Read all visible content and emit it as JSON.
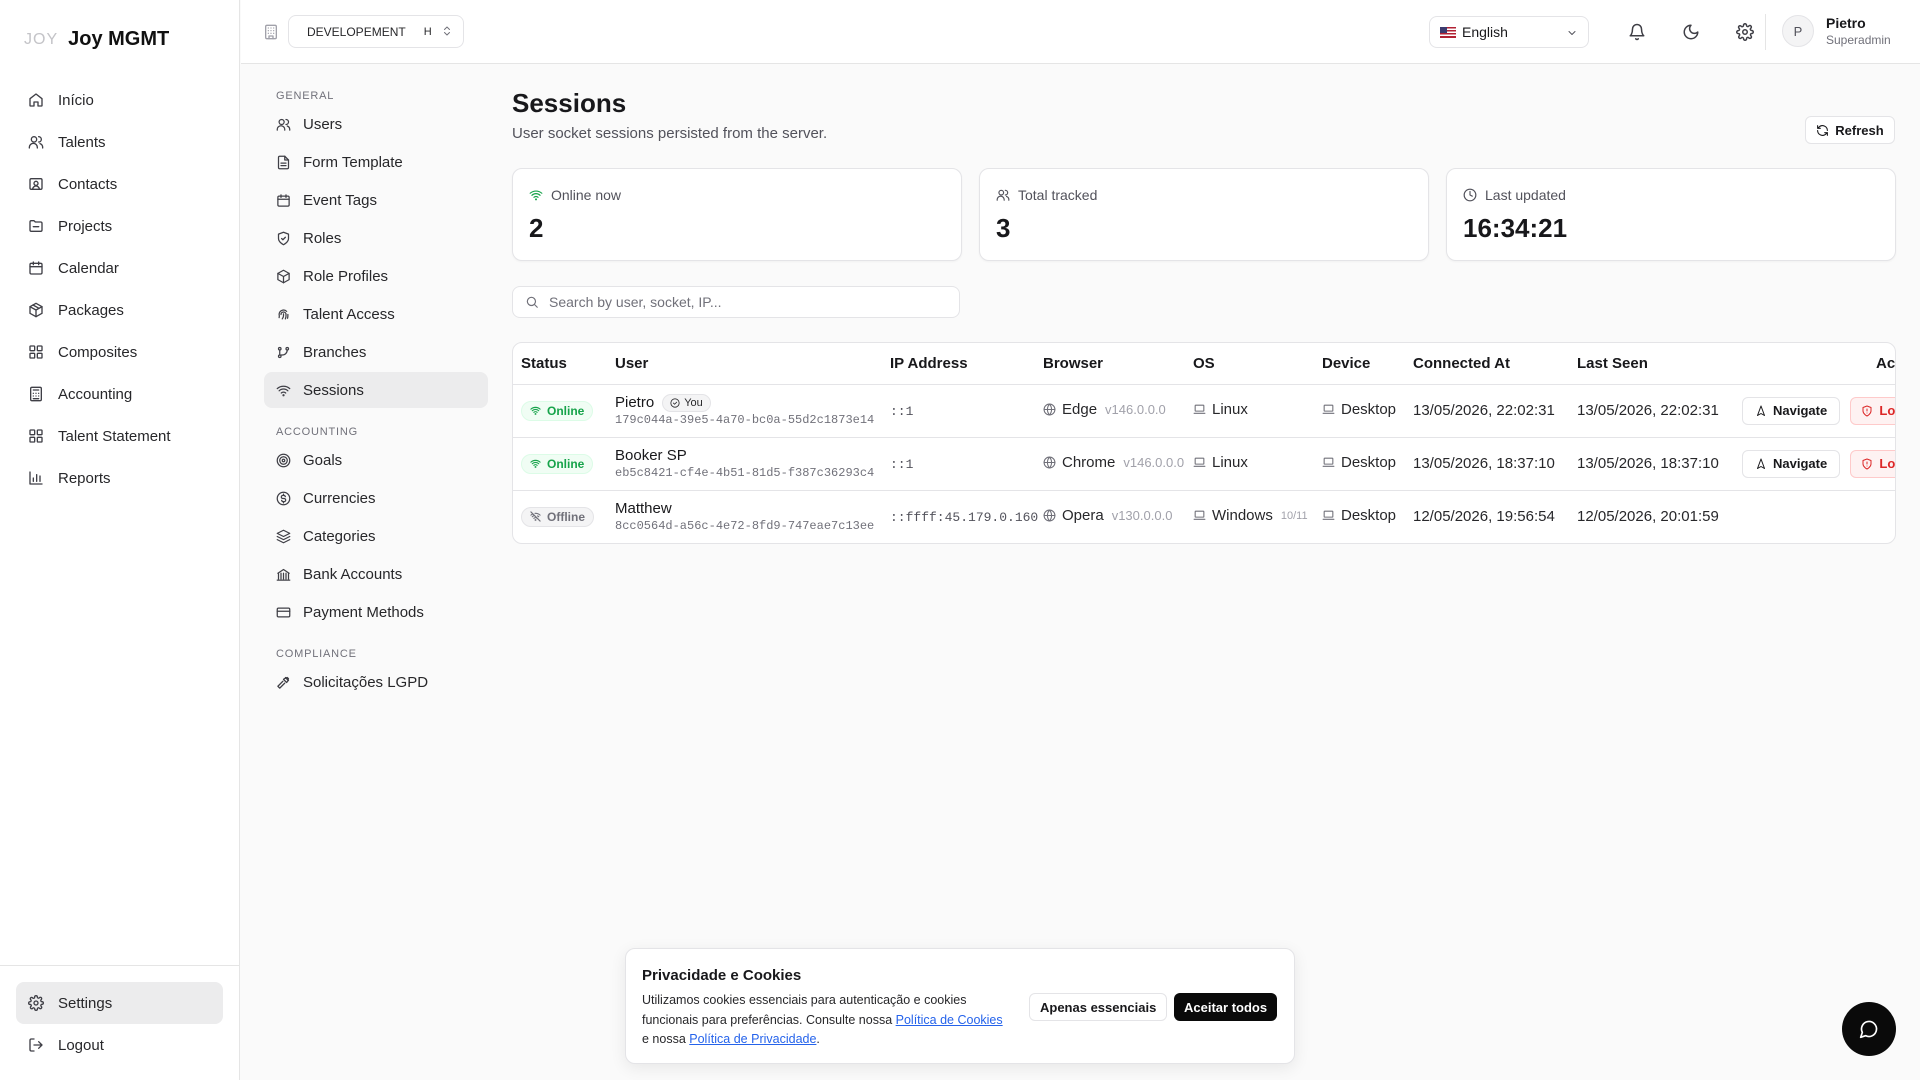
{
  "brand": {
    "logo": "JOY",
    "name": "Joy MGMT"
  },
  "sidebar": {
    "items": [
      {
        "label": "Início",
        "icon": "home-icon"
      },
      {
        "label": "Talents",
        "icon": "users-icon"
      },
      {
        "label": "Contacts",
        "icon": "contact-card-icon"
      },
      {
        "label": "Projects",
        "icon": "folder-icon"
      },
      {
        "label": "Calendar",
        "icon": "calendar-icon"
      },
      {
        "label": "Packages",
        "icon": "package-icon"
      },
      {
        "label": "Composites",
        "icon": "grid-icon"
      },
      {
        "label": "Accounting",
        "icon": "calculator-icon"
      },
      {
        "label": "Talent Statement",
        "icon": "grid-icon"
      },
      {
        "label": "Reports",
        "icon": "bar-chart-icon"
      }
    ],
    "settings_label": "Settings",
    "logout_label": "Logout"
  },
  "header": {
    "environment": "DEVELOPEMENT",
    "environment_badge": "H",
    "language": "English",
    "user_name": "Pietro",
    "user_role": "Superadmin",
    "avatar_initial": "P"
  },
  "subnav": {
    "general_label": "GENERAL",
    "general_items": [
      {
        "label": "Users"
      },
      {
        "label": "Form Template"
      },
      {
        "label": "Event Tags"
      },
      {
        "label": "Roles"
      },
      {
        "label": "Role Profiles"
      },
      {
        "label": "Talent Access"
      },
      {
        "label": "Branches"
      },
      {
        "label": "Sessions"
      }
    ],
    "accounting_label": "ACCOUNTING",
    "accounting_items": [
      {
        "label": "Goals"
      },
      {
        "label": "Currencies"
      },
      {
        "label": "Categories"
      },
      {
        "label": "Bank Accounts"
      },
      {
        "label": "Payment Methods"
      }
    ],
    "compliance_label": "COMPLIANCE",
    "compliance_items": [
      {
        "label": "Solicitações LGPD"
      }
    ]
  },
  "page": {
    "title": "Sessions",
    "subtitle": "User socket sessions persisted from the server.",
    "refresh_label": "Refresh"
  },
  "stats": {
    "online": {
      "label": "Online now",
      "value": "2"
    },
    "total": {
      "label": "Total tracked",
      "value": "3"
    },
    "updated": {
      "label": "Last updated",
      "value": "16:34:21"
    }
  },
  "search": {
    "placeholder": "Search by user, socket, IP..."
  },
  "table": {
    "headers": {
      "status": "Status",
      "user": "User",
      "ip": "IP Address",
      "browser": "Browser",
      "os": "OS",
      "device": "Device",
      "connected": "Connected At",
      "last_seen": "Last Seen",
      "actions": "Ac"
    },
    "you_label": "You",
    "navigate_label": "Navigate",
    "logout_label": "Lo",
    "rows": [
      {
        "status": "Online",
        "name": "Pietro",
        "socket": "179c044a-39e5-4a70-bc0a-55d2c1873e14",
        "ip": "::1",
        "browser": "Edge",
        "browser_version": "v146.0.0.0",
        "os": "Linux",
        "os_version": "",
        "device": "Desktop",
        "connected_at": "13/05/2026, 22:02:31",
        "last_seen": "13/05/2026, 22:02:31"
      },
      {
        "status": "Online",
        "name": "Booker SP",
        "socket": "eb5c8421-cf4e-4b51-81d5-f387c36293c4",
        "ip": "::1",
        "browser": "Chrome",
        "browser_version": "v146.0.0.0",
        "os": "Linux",
        "os_version": "",
        "device": "Desktop",
        "connected_at": "13/05/2026, 18:37:10",
        "last_seen": "13/05/2026, 18:37:10"
      },
      {
        "status": "Offline",
        "name": "Matthew",
        "socket": "8cc0564d-a56c-4e72-8fd9-747eae7c13ee",
        "ip": "::ffff:45.179.0.160",
        "browser": "Opera",
        "browser_version": "v130.0.0.0",
        "os": "Windows",
        "os_version": "10/11",
        "device": "Desktop",
        "connected_at": "12/05/2026, 19:56:54",
        "last_seen": "12/05/2026, 20:01:59"
      }
    ]
  },
  "cookie": {
    "title": "Privacidade e Cookies",
    "text_1": "Utilizamos cookies essenciais para autenticação e cookies funcionais para preferências. Consulte nossa ",
    "link_1": "Política de Cookies",
    "text_2": " e nossa ",
    "link_2": "Política de Privacidade",
    "text_3": ".",
    "essentials_label": "Apenas essenciais",
    "accept_label": "Aceitar todos"
  },
  "colors": {
    "online": "#16a34a",
    "offline": "#71717a",
    "danger": "#dc2626",
    "link": "#2563eb",
    "active_bg": "#ececed"
  }
}
